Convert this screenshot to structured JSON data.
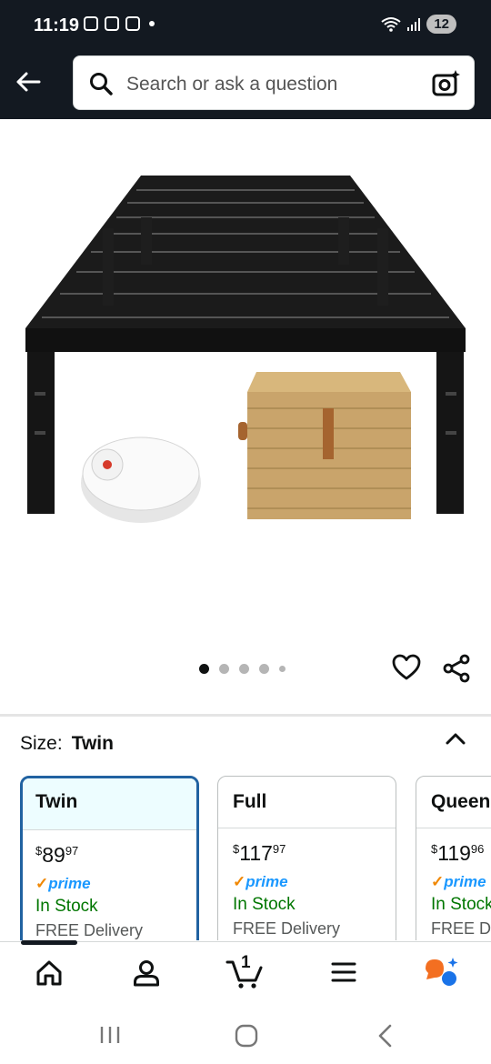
{
  "status_bar": {
    "time": "11:19",
    "battery": "12"
  },
  "search": {
    "placeholder": "Search or ask a question"
  },
  "image_carousel": {
    "dot_count": 5,
    "active_index": 0
  },
  "size_selector": {
    "label": "Size:",
    "selected": "Twin",
    "options": [
      {
        "name": "Twin",
        "price_dollar": "$",
        "price_whole": "89",
        "price_cents": "97",
        "prime": "prime",
        "stock": "In Stock",
        "delivery": "FREE Delivery"
      },
      {
        "name": "Full",
        "price_dollar": "$",
        "price_whole": "117",
        "price_cents": "97",
        "prime": "prime",
        "stock": "In Stock",
        "delivery": "FREE Delivery"
      },
      {
        "name": "Queen",
        "price_dollar": "$",
        "price_whole": "119",
        "price_cents": "96",
        "prime": "prime",
        "stock": "In Stock",
        "delivery": "FREE Delivery"
      }
    ]
  },
  "bottom_nav": {
    "cart_count": "1"
  },
  "colors": {
    "header_bg": "#131921",
    "selected_border": "#2162a1",
    "in_stock": "#007600",
    "prime_blue": "#1a98ff",
    "rufus_orange": "#f36f21"
  }
}
